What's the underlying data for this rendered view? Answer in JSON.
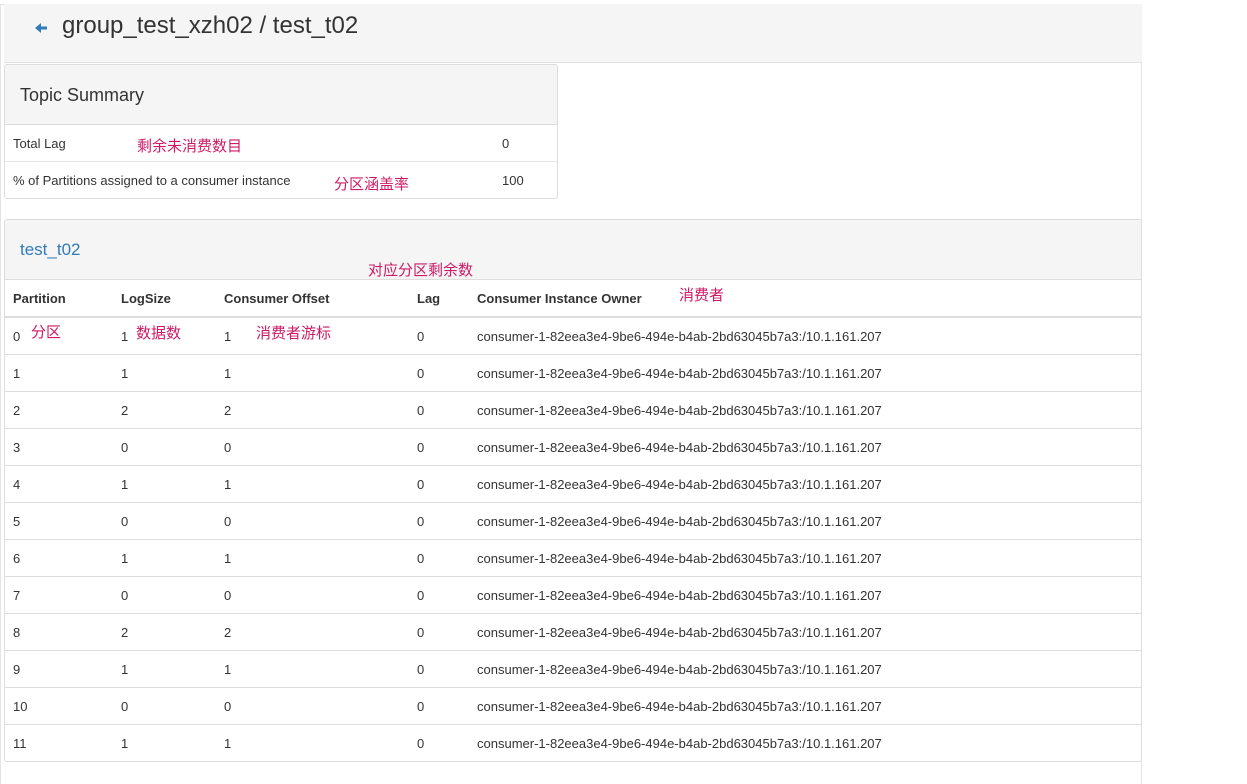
{
  "header": {
    "title": "group_test_xzh02 / test_t02",
    "back_icon": "arrow-left-icon"
  },
  "summary": {
    "title": "Topic Summary",
    "rows": [
      {
        "label": "Total Lag",
        "value": "0",
        "annotation": "剩余未消费数目"
      },
      {
        "label": "% of Partitions assigned to a consumer instance",
        "value": "100",
        "annotation": "分区涵盖率"
      }
    ]
  },
  "topic": {
    "title": "test_t02",
    "columns": [
      "Partition",
      "LogSize",
      "Consumer Offset",
      "Lag",
      "Consumer Instance Owner"
    ],
    "rows": [
      [
        "0",
        "1",
        "1",
        "0",
        "consumer-1-82eea3e4-9be6-494e-b4ab-2bd63045b7a3:/10.1.161.207"
      ],
      [
        "1",
        "1",
        "1",
        "0",
        "consumer-1-82eea3e4-9be6-494e-b4ab-2bd63045b7a3:/10.1.161.207"
      ],
      [
        "2",
        "2",
        "2",
        "0",
        "consumer-1-82eea3e4-9be6-494e-b4ab-2bd63045b7a3:/10.1.161.207"
      ],
      [
        "3",
        "0",
        "0",
        "0",
        "consumer-1-82eea3e4-9be6-494e-b4ab-2bd63045b7a3:/10.1.161.207"
      ],
      [
        "4",
        "1",
        "1",
        "0",
        "consumer-1-82eea3e4-9be6-494e-b4ab-2bd63045b7a3:/10.1.161.207"
      ],
      [
        "5",
        "0",
        "0",
        "0",
        "consumer-1-82eea3e4-9be6-494e-b4ab-2bd63045b7a3:/10.1.161.207"
      ],
      [
        "6",
        "1",
        "1",
        "0",
        "consumer-1-82eea3e4-9be6-494e-b4ab-2bd63045b7a3:/10.1.161.207"
      ],
      [
        "7",
        "0",
        "0",
        "0",
        "consumer-1-82eea3e4-9be6-494e-b4ab-2bd63045b7a3:/10.1.161.207"
      ],
      [
        "8",
        "2",
        "2",
        "0",
        "consumer-1-82eea3e4-9be6-494e-b4ab-2bd63045b7a3:/10.1.161.207"
      ],
      [
        "9",
        "1",
        "1",
        "0",
        "consumer-1-82eea3e4-9be6-494e-b4ab-2bd63045b7a3:/10.1.161.207"
      ],
      [
        "10",
        "0",
        "0",
        "0",
        "consumer-1-82eea3e4-9be6-494e-b4ab-2bd63045b7a3:/10.1.161.207"
      ],
      [
        "11",
        "1",
        "1",
        "0",
        "consumer-1-82eea3e4-9be6-494e-b4ab-2bd63045b7a3:/10.1.161.207"
      ]
    ]
  },
  "annotations": {
    "lag": "对应分区剩余数",
    "owner": "消费者",
    "partition": "分区",
    "logsize": "数据数",
    "offset": "消费者游标"
  },
  "colors": {
    "accent": "#337ab7",
    "annotation": "#cc1a66",
    "panel_bg": "#f5f5f5"
  }
}
